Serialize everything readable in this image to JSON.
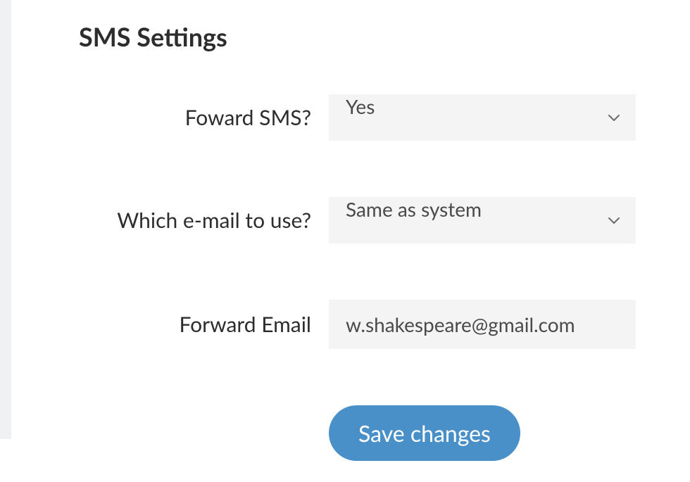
{
  "title": "SMS Settings",
  "fields": {
    "forward_sms": {
      "label": "Foward SMS?",
      "value": "Yes"
    },
    "which_email": {
      "label": "Which e-mail to use?",
      "value": "Same as system"
    },
    "forward_email": {
      "label": "Forward Email",
      "value": "w.shakespeare@gmail.com"
    }
  },
  "actions": {
    "save_label": "Save changes"
  }
}
